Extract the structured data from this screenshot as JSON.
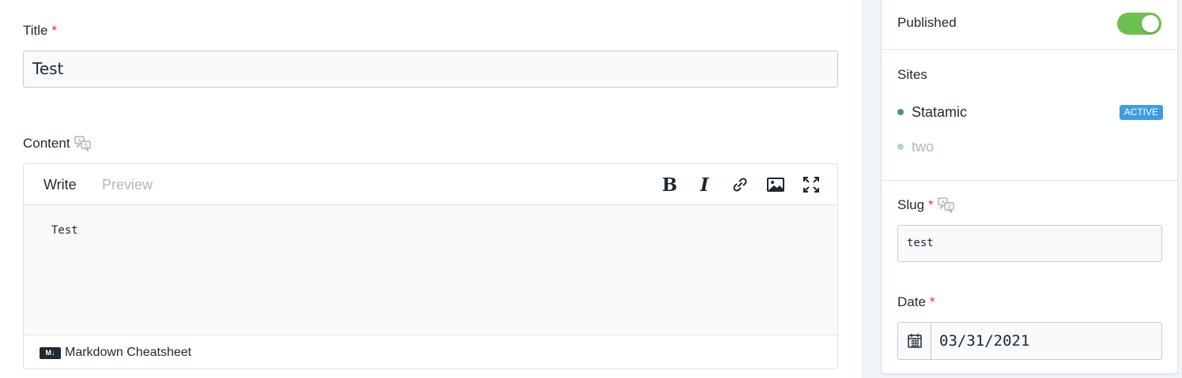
{
  "title_field": {
    "label": "Title",
    "required_mark": "*",
    "value": "Test"
  },
  "content_field": {
    "label": "Content",
    "translate_icon": "translate-icon",
    "tabs": [
      {
        "label": "Write",
        "active": true
      },
      {
        "label": "Preview",
        "active": false
      }
    ],
    "toolbar": {
      "bold_label": "B",
      "italic_label": "I",
      "link_icon": "link-icon",
      "image_icon": "image-icon",
      "fullscreen_icon": "fullscreen-icon"
    },
    "body_text": "Test",
    "footer": {
      "badge_icon": "markdown-icon",
      "badge_text": "M↓",
      "link_label": "Markdown Cheatsheet"
    }
  },
  "sidebar": {
    "published": {
      "label": "Published",
      "enabled": true
    },
    "sites": {
      "heading": "Sites",
      "items": [
        {
          "name": "Statamic",
          "badge": "ACTIVE",
          "active": true
        },
        {
          "name": "two",
          "badge": "",
          "active": false
        }
      ]
    },
    "slug": {
      "label": "Slug",
      "required_mark": "*",
      "value": "test"
    },
    "date": {
      "label": "Date",
      "required_mark": "*",
      "calendar_icon": "calendar-icon",
      "value": "03/31/2021"
    }
  },
  "colors": {
    "required": "#e3342f",
    "toggle_on": "#6ebf54",
    "badge_active": "#3d9ce6",
    "dot_active": "#4b9a62",
    "dot_inactive": "#b4d8bf",
    "muted_text": "#b0b8c1"
  }
}
